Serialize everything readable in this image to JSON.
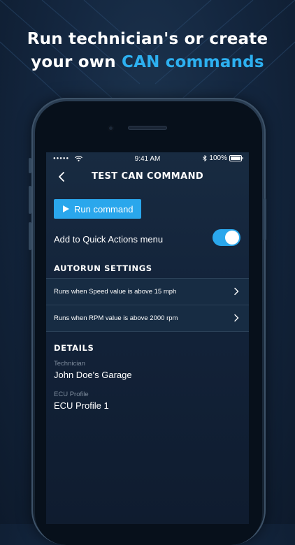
{
  "promo": {
    "line1": "Run technician's or create",
    "line2_prefix": "your own ",
    "line2_accent": "CAN commands",
    "accent_color": "#2db0f0"
  },
  "status_bar": {
    "signal": "●●●●●",
    "time": "9:41 AM",
    "battery": "100%"
  },
  "nav": {
    "title": "TEST CAN COMMAND",
    "back_icon": "chevron-left-icon"
  },
  "actions": {
    "run_label": "Run command",
    "run_icon": "play-icon",
    "quick_actions_label": "Add to Quick Actions menu",
    "quick_actions_enabled": true
  },
  "autorun": {
    "title": "AUTORUN SETTINGS",
    "items": [
      {
        "label": "Runs when Speed value is above 15 mph"
      },
      {
        "label": "Runs when RPM value is above 2000 rpm"
      }
    ]
  },
  "details": {
    "title": "DETAILS",
    "technician_label": "Technician",
    "technician_value": "John Doe's Garage",
    "ecu_label": "ECU Profile",
    "ecu_value": "ECU Profile 1"
  },
  "colors": {
    "accent": "#2aa7ec",
    "background": "#142740",
    "screen": "#13233a"
  }
}
